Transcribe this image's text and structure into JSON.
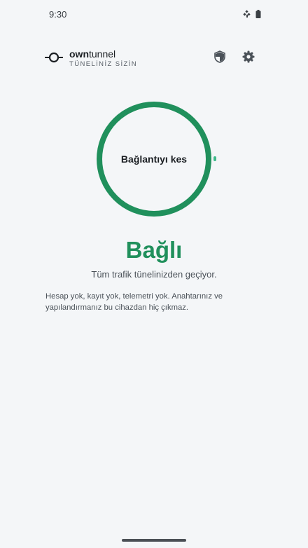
{
  "status_bar": {
    "time": "9:30",
    "icons": [
      "satellite-icon",
      "battery-icon"
    ]
  },
  "header": {
    "brand_prefix": "own",
    "brand_suffix": "tunnel",
    "tagline": "TÜNELİNİZ SİZİN",
    "icons": [
      "tunnel-logo-icon",
      "shield-icon",
      "gear-icon"
    ]
  },
  "connect": {
    "button_label": "Bağlantıyı kes",
    "status_title": "Bağlı",
    "status_subtitle": "Tüm trafik tünelinizden geçiyor.",
    "privacy_note": "Hesap yok, kayıt yok, telemetri yok. Anahtarınız ve yapılandırmanız bu cihazdan hiç çıkmaz.",
    "accent_color": "#20905c"
  }
}
